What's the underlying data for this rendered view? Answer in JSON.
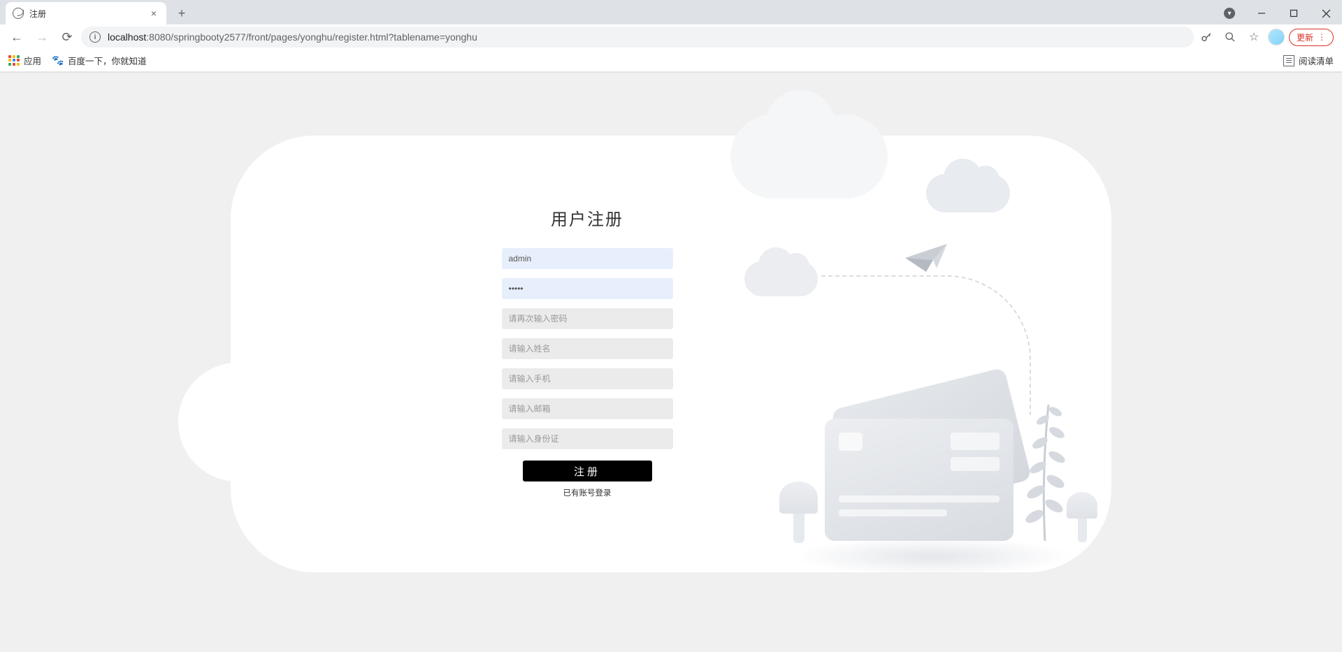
{
  "browser": {
    "tab_title": "注册",
    "url_host": "localhost",
    "url_port_path": ":8080/springbooty2577/front/pages/yonghu/register.html?tablename=yonghu",
    "update_label": "更新"
  },
  "bookmarks": {
    "apps_label": "应用",
    "baidu_label": "百度一下，你就知道",
    "reading_list_label": "阅读清单"
  },
  "form": {
    "title": "用户注册",
    "username_value": "admin",
    "password_value": "•••••",
    "confirm_placeholder": "请再次输入密码",
    "name_placeholder": "请输入姓名",
    "phone_placeholder": "请输入手机",
    "email_placeholder": "请输入邮箱",
    "idcard_placeholder": "请输入身份证",
    "submit_label": "注册",
    "login_link_label": "已有账号登录"
  }
}
